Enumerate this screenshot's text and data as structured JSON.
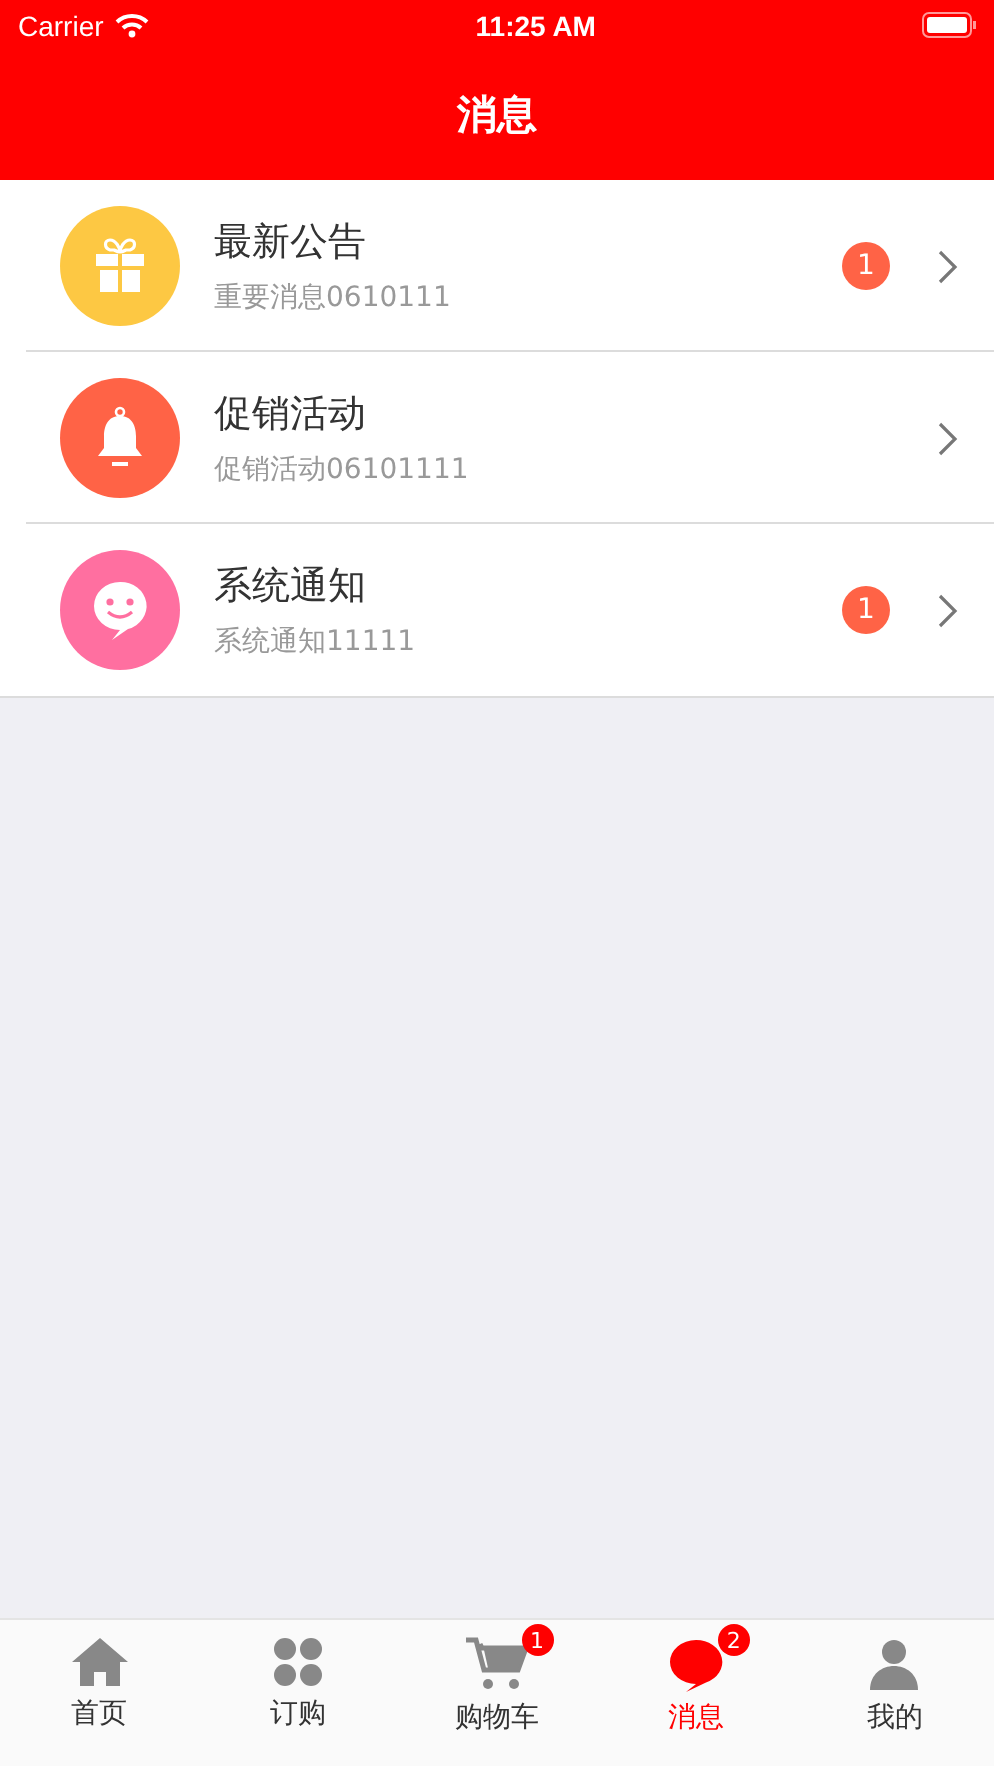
{
  "status_bar": {
    "carrier": "Carrier",
    "time": "11:25 AM"
  },
  "nav_bar": {
    "title": "消息"
  },
  "messages": [
    {
      "kind": "gift",
      "title": "最新公告",
      "subtitle": "重要消息0610111",
      "badge": "1"
    },
    {
      "kind": "bell",
      "title": "促销活动",
      "subtitle": "促销活动06101111"
    },
    {
      "kind": "chat",
      "title": "系统通知",
      "subtitle": "系统通知11111",
      "badge": "1"
    }
  ],
  "tab_bar": [
    {
      "kind": "home",
      "label": "首页",
      "selected": false
    },
    {
      "kind": "grid",
      "label": "订购",
      "selected": false
    },
    {
      "kind": "cart",
      "label": "购物车",
      "selected": false,
      "badge": "1"
    },
    {
      "kind": "message",
      "label": "消息",
      "selected": true,
      "badge": "2"
    },
    {
      "kind": "person",
      "label": "我的",
      "selected": false
    }
  ]
}
